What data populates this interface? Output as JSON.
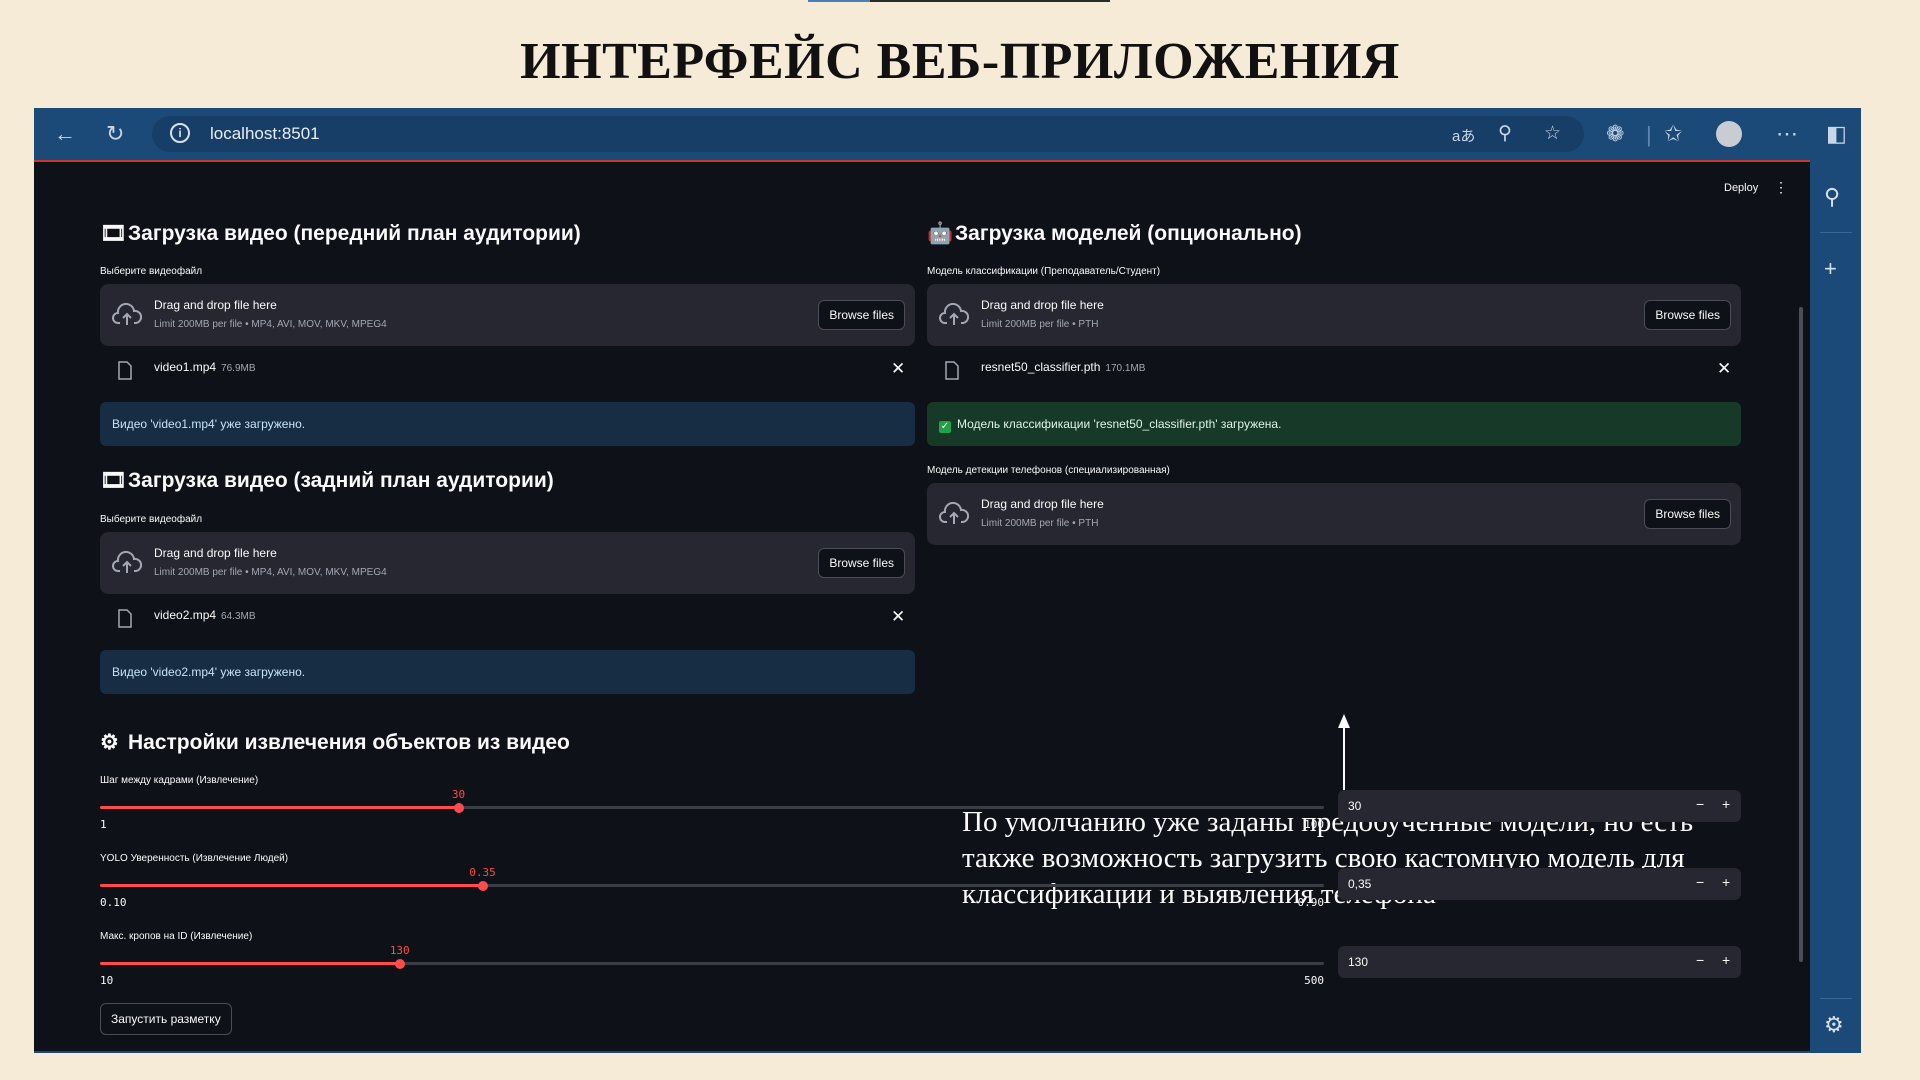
{
  "slide": {
    "title": "ИНТЕРФЕЙС ВЕБ-ПРИЛОЖЕНИЯ"
  },
  "browser": {
    "url": "localhost:8501",
    "icons": [
      "back-icon",
      "refresh-icon",
      "info-icon",
      "read-aloud-icon",
      "zoom-out-icon",
      "favorite-star-icon",
      "extensions-icon",
      "favorites-icon",
      "profile-icon",
      "more-icon",
      "sidebar-toggle-icon",
      "search-icon",
      "add-icon",
      "settings-icon"
    ]
  },
  "app": {
    "deploy_label": "Deploy",
    "video_front": {
      "header": "Загрузка видео (передний план аудитории)",
      "label": "Выберите видеофайл",
      "dropzone_title": "Drag and drop file here",
      "dropzone_limit": "Limit 200MB per file • MP4, AVI, MOV, MKV, MPEG4",
      "browse_label": "Browse files",
      "file_name": "video1.mp4",
      "file_size": "76.9MB",
      "status": "Видео 'video1.mp4' уже загружено."
    },
    "video_back": {
      "header": "Загрузка видео (задний план аудитории)",
      "label": "Выберите видеофайл",
      "dropzone_title": "Drag and drop file here",
      "dropzone_limit": "Limit 200MB per file • MP4, AVI, MOV, MKV, MPEG4",
      "browse_label": "Browse files",
      "file_name": "video2.mp4",
      "file_size": "64.3MB",
      "status": "Видео 'video2.mp4' уже загружено."
    },
    "models": {
      "header": "Загрузка моделей (опционально)",
      "classifier": {
        "label": "Модель классификации (Преподаватель/Студент)",
        "dropzone_title": "Drag and drop file here",
        "dropzone_limit": "Limit 200MB per file • PTH",
        "browse_label": "Browse files",
        "file_name": "resnet50_classifier.pth",
        "file_size": "170.1MB",
        "status": "Модель классификации 'resnet50_classifier.pth' загружена."
      },
      "phone": {
        "label": "Модель детекции телефонов (специализированная)",
        "dropzone_title": "Drag and drop file here",
        "dropzone_limit": "Limit 200MB per file • PTH",
        "browse_label": "Browse files"
      }
    },
    "settings": {
      "header": "Настройки извлечения объектов из видео",
      "sliders": [
        {
          "label": "Шаг между кадрами (Извлечение)",
          "value_label": "30",
          "min_label": "1",
          "max_label": "100",
          "min": 1,
          "max": 100,
          "value": 30,
          "input_value": "30"
        },
        {
          "label": "YOLO Уверенность (Извлечение Людей)",
          "value_label": "0.35",
          "min_label": "0.10",
          "max_label": "0.90",
          "min": 0.1,
          "max": 0.9,
          "value": 0.35,
          "input_value": "0,35"
        },
        {
          "label": "Макс. кропов на ID (Извлечение)",
          "value_label": "130",
          "min_label": "10",
          "max_label": "500",
          "min": 10,
          "max": 500,
          "value": 130,
          "input_value": "130"
        }
      ],
      "minus": "−",
      "plus": "+",
      "run_button": "Запустить разметку"
    },
    "note": "По умолчанию уже заданы  предобученные модели, но есть также возможность загрузить свою кастомную модель для классификации и выявления телефона"
  },
  "colors": {
    "accent": "#ff4b4b",
    "app_bg": "#0e1117",
    "browser_frame": "#1b4a78",
    "slide_bg": "#f6ebd6"
  }
}
